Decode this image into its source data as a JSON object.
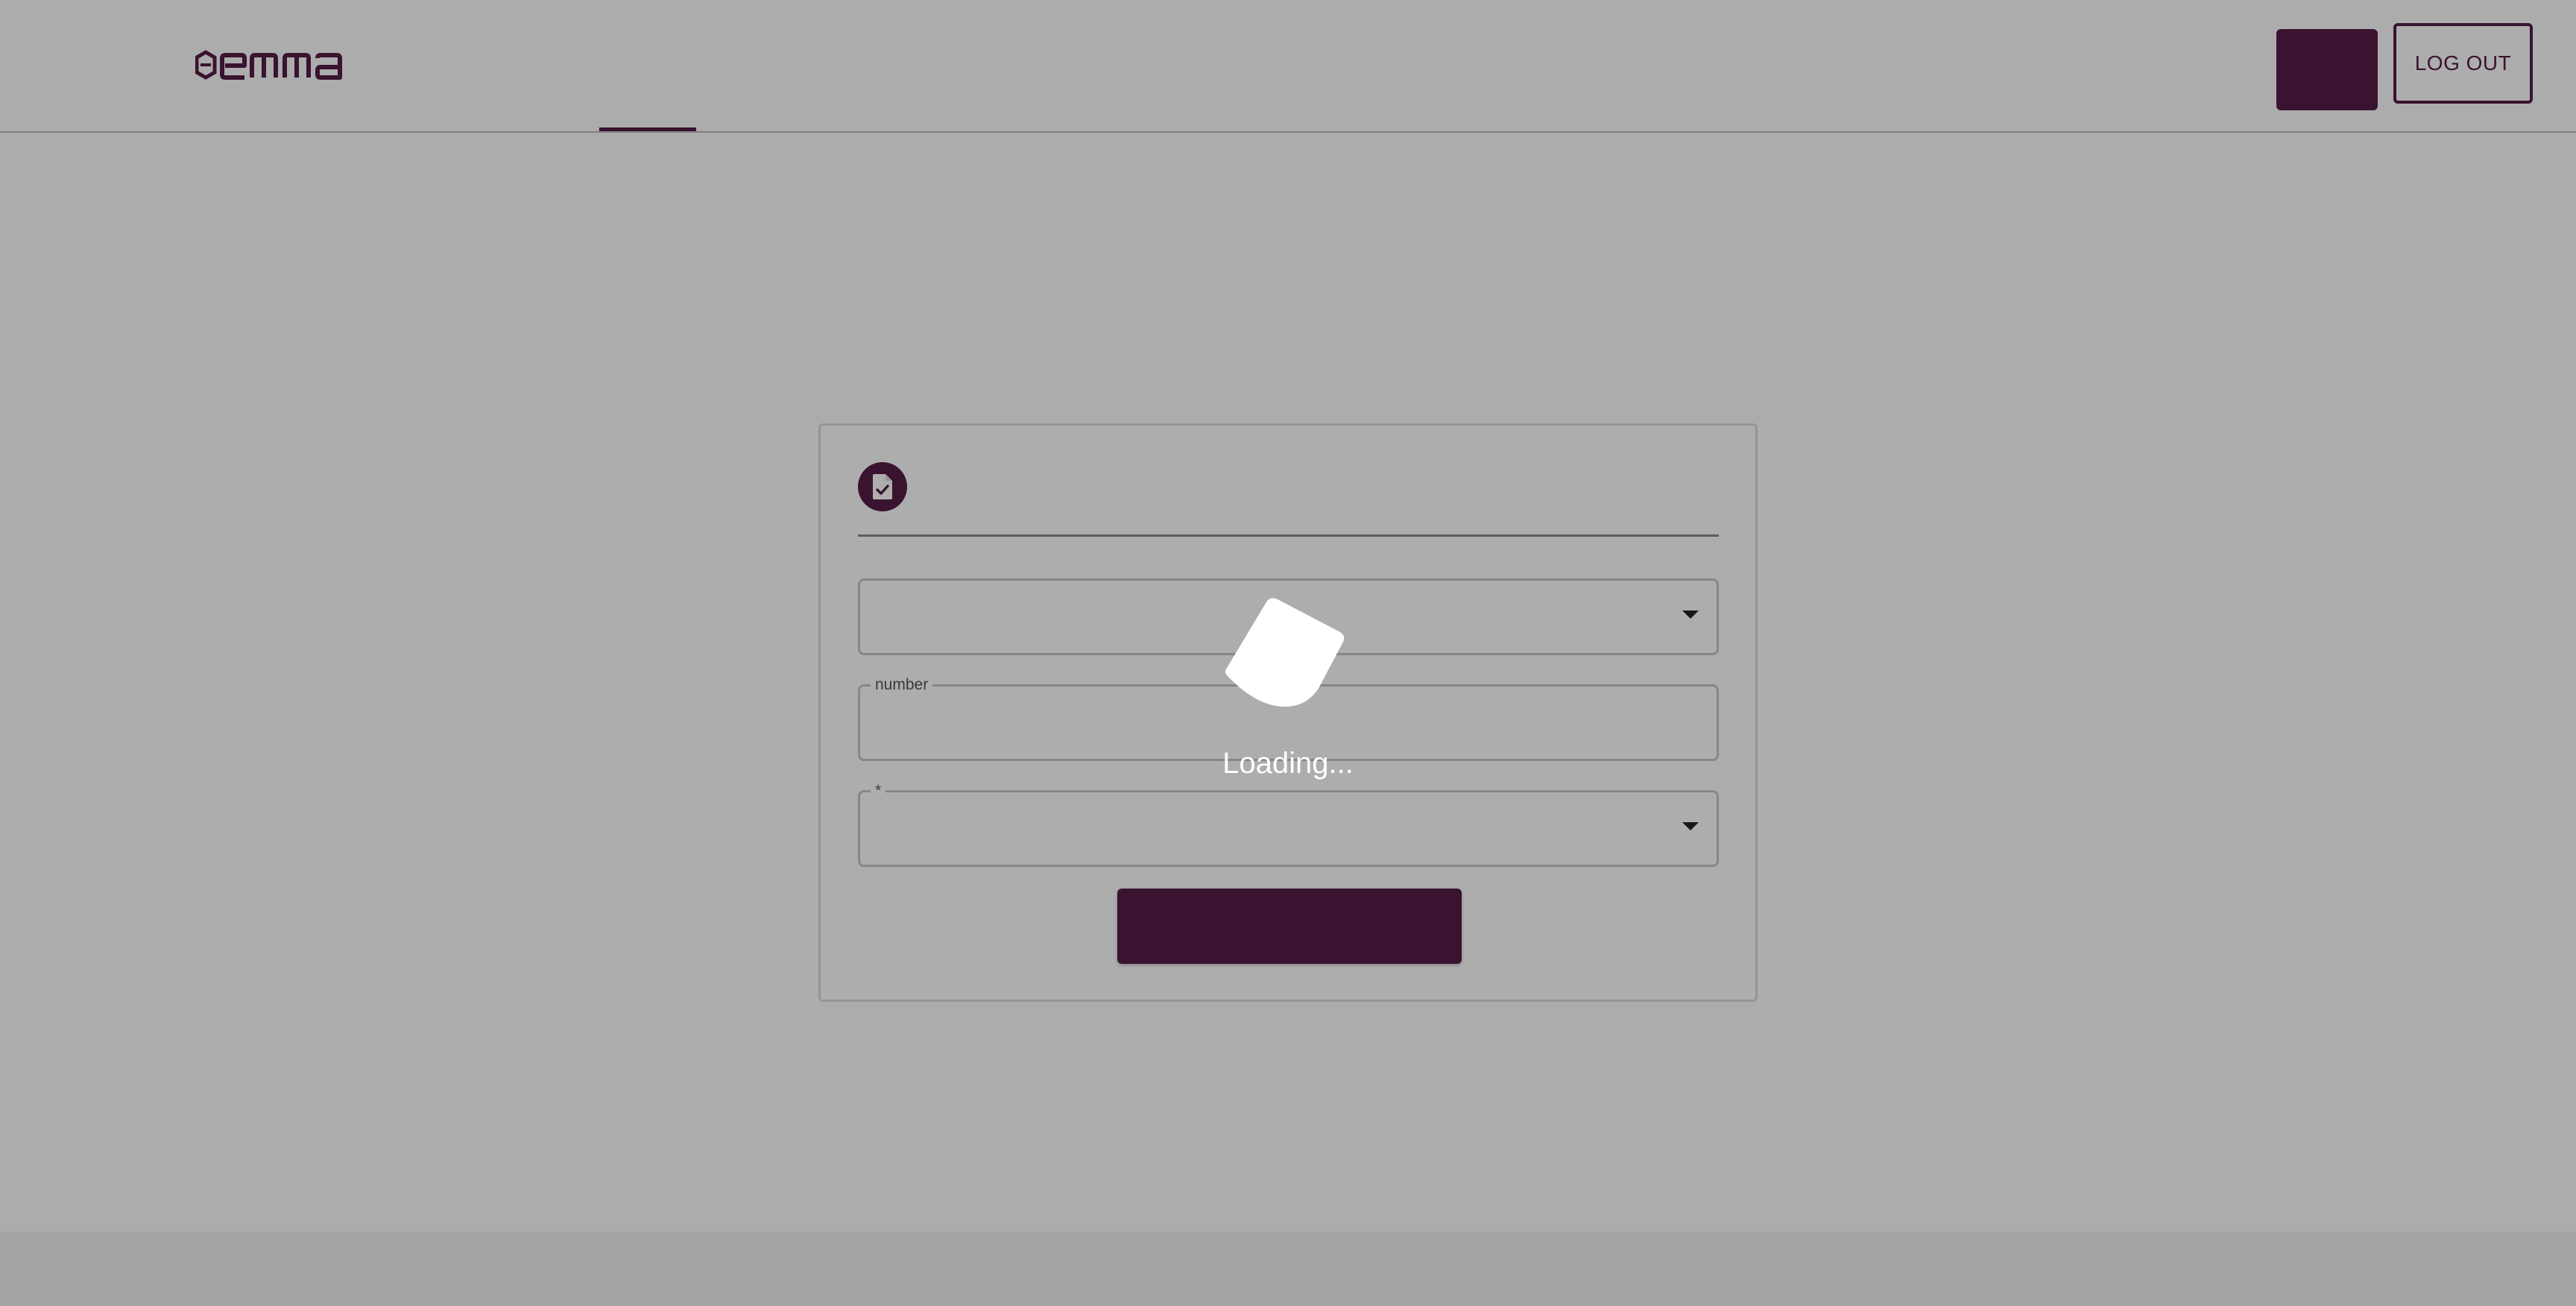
{
  "header": {
    "logo_text": "emma",
    "logo_icon": "emma-e-icon",
    "logout_label": "LOG OUT",
    "primary_button_label": ""
  },
  "form": {
    "header_icon": "document-check-icon",
    "fields": [
      {
        "label": "",
        "type": "select",
        "value": ""
      },
      {
        "label": "number",
        "type": "input",
        "value": ""
      },
      {
        "label": "*",
        "type": "select",
        "value": ""
      }
    ],
    "submit_label": ""
  },
  "overlay": {
    "loading_text": "Loading...",
    "spinner_icon": "loading-spinner-icon"
  },
  "colors": {
    "brand": "#541c46",
    "overlay": "rgba(0,0,0,0.32)",
    "background": "#fefefe"
  }
}
